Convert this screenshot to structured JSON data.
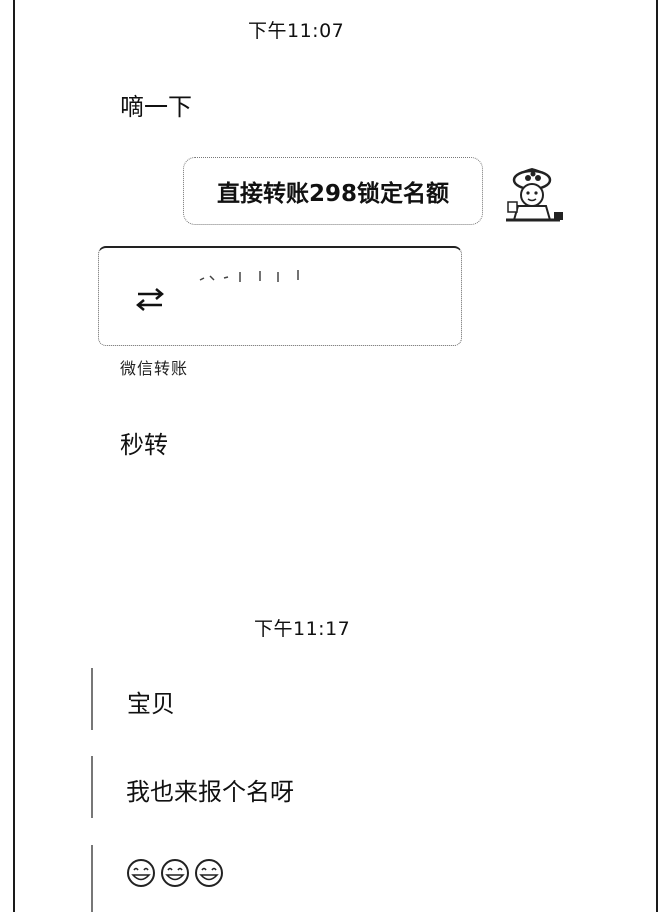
{
  "chat": {
    "time_1": "下午11:07",
    "msg_1": "嘀一下",
    "msg_out": "直接转账298锁定名额",
    "transfer_label": "微信转账",
    "msg_2": "秒转",
    "time_2": "下午11:17",
    "msg_3": "宝贝",
    "msg_4": "我也来报个名呀",
    "emojis": [
      "smile-emoji",
      "smile-emoji",
      "smile-emoji"
    ]
  },
  "icons": {
    "avatar": "avatar-icon",
    "transfer": "transfer-icon"
  }
}
